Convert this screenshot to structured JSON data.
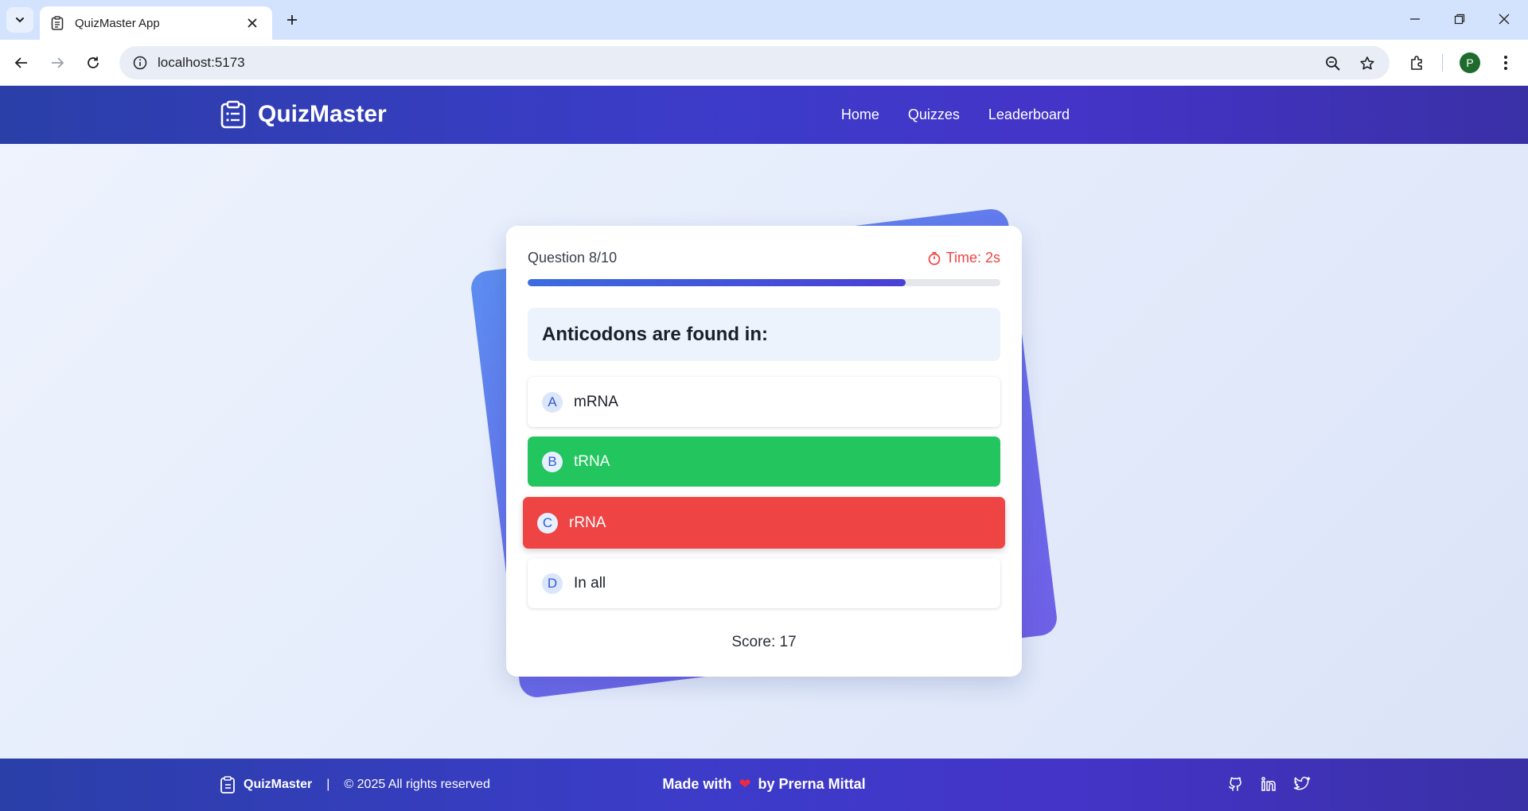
{
  "browser": {
    "tab_title": "QuizMaster App",
    "url": "localhost:5173",
    "profile_initial": "P"
  },
  "header": {
    "brand": "QuizMaster",
    "nav": [
      "Home",
      "Quizzes",
      "Leaderboard"
    ]
  },
  "quiz": {
    "question_counter": "Question 8/10",
    "timer_label": "Time: 2s",
    "progress_fraction": 0.8,
    "question": "Anticodons are found in:",
    "options": [
      {
        "letter": "A",
        "text": "mRNA",
        "state": "default"
      },
      {
        "letter": "B",
        "text": "tRNA",
        "state": "correct"
      },
      {
        "letter": "C",
        "text": "rRNA",
        "state": "wrong"
      },
      {
        "letter": "D",
        "text": "In all",
        "state": "default"
      }
    ],
    "score_label": "Score: 17"
  },
  "footer": {
    "brand": "QuizMaster",
    "separator": "|",
    "copyright": "© 2025 All rights reserved",
    "made_with": "Made with",
    "heart": "❤",
    "by": "by Prerna Mittal"
  },
  "colors": {
    "header_gradient_start": "#2a3fa8",
    "header_gradient_end": "#4434c8",
    "correct": "#22c55e",
    "wrong": "#ef4444",
    "timer": "#ef4444"
  }
}
